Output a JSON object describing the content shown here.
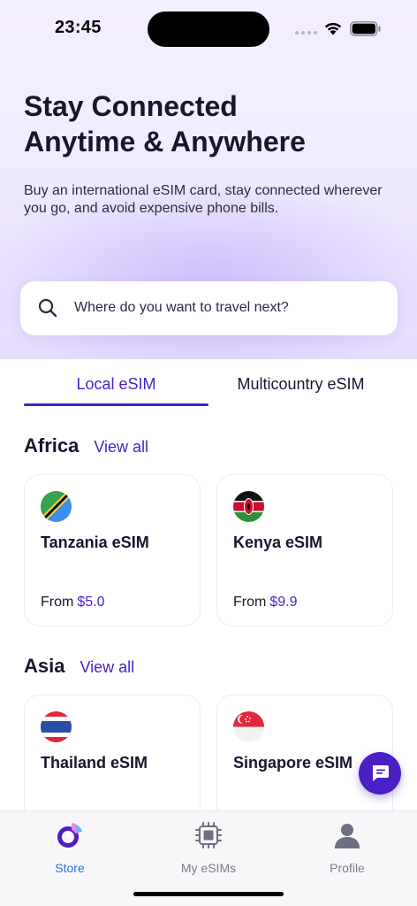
{
  "status_bar": {
    "time": "23:45"
  },
  "hero": {
    "title_line1": "Stay Connected",
    "title_line2": "Anytime & Anywhere",
    "subtitle": "Buy an international eSIM card, stay connected wherever you go, and avoid expensive phone bills."
  },
  "search": {
    "placeholder": "Where do you want to travel next?",
    "icon": "search-icon"
  },
  "tabs": [
    {
      "label": "Local eSIM",
      "active": true
    },
    {
      "label": "Multicountry eSIM",
      "active": false
    }
  ],
  "sections": [
    {
      "title": "Africa",
      "view_all": "View all",
      "cards": [
        {
          "name": "Tanzania eSIM",
          "from": "From",
          "price": "$5.0",
          "flag": "tanzania-flag-icon"
        },
        {
          "name": "Kenya eSIM",
          "from": "From",
          "price": "$9.9",
          "flag": "kenya-flag-icon"
        }
      ]
    },
    {
      "title": "Asia",
      "view_all": "View all",
      "cards": [
        {
          "name": "Thailand eSIM",
          "flag": "thailand-flag-icon"
        },
        {
          "name": "Singapore eSIM",
          "flag": "singapore-flag-icon"
        }
      ]
    }
  ],
  "tabbar": [
    {
      "label": "Store",
      "icon": "store-icon",
      "active": true
    },
    {
      "label": "My eSIMs",
      "icon": "sim-chip-icon",
      "active": false
    },
    {
      "label": "Profile",
      "icon": "profile-icon",
      "active": false
    }
  ],
  "colors": {
    "accent": "#4a1fc4",
    "tab_active": "#2f6fe6",
    "text": "#15172b"
  }
}
